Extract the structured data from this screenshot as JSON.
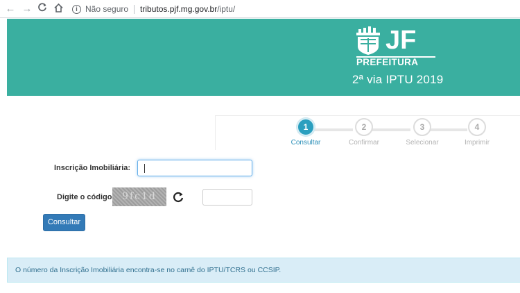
{
  "browser": {
    "security_label": "Não seguro",
    "url_host": "tributos.pjf.mg.gov.br",
    "url_path": "/iptu/"
  },
  "header": {
    "logo_text_top": "JF",
    "logo_text_bottom": "PREFEITURA",
    "title": "2ª via IPTU 2019",
    "background_color": "#3aafa0"
  },
  "wizard": {
    "steps": [
      {
        "number": "1",
        "label": "Consultar",
        "active": true
      },
      {
        "number": "2",
        "label": "Confirmar",
        "active": false
      },
      {
        "number": "3",
        "label": "Selecionar",
        "active": false
      },
      {
        "number": "4",
        "label": "Imprimir",
        "active": false
      }
    ]
  },
  "form": {
    "inscricao_label": "Inscrição Imobiliária:",
    "inscricao_value": "",
    "codigo_label": "Digite o código:",
    "captcha_text": "9fc1d",
    "codigo_value": "",
    "submit_label": "Consultar"
  },
  "alert": {
    "text": "O número da Inscrição Imobiliária encontra-se no carnê do IPTU/TCRS ou CCSIP."
  }
}
